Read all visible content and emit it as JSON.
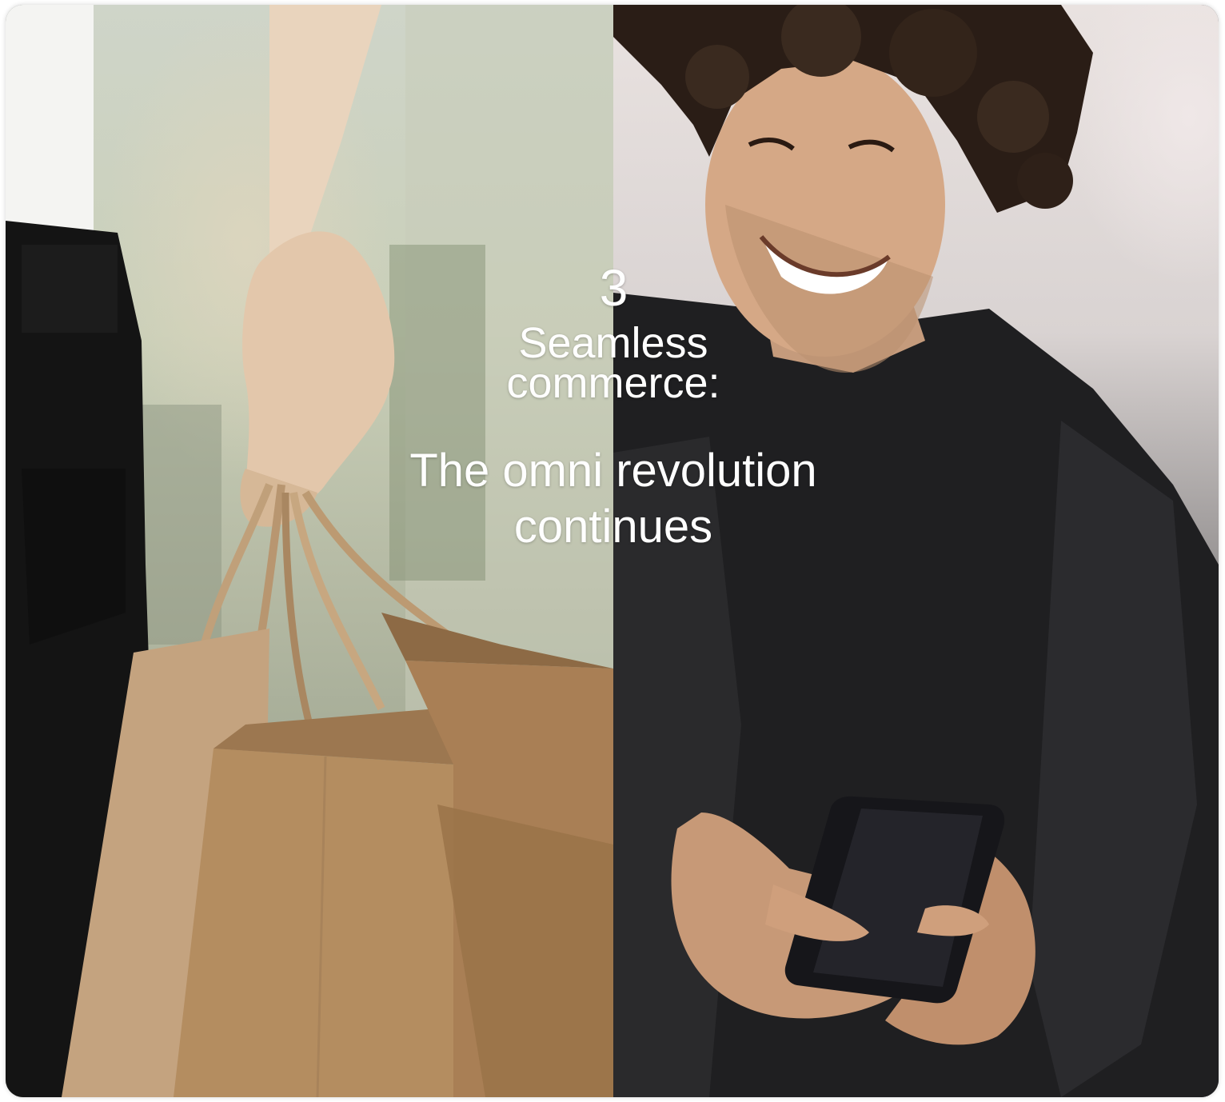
{
  "card": {
    "step_number": "3",
    "title_line_1": "Seamless",
    "title_line_2": "commerce:",
    "subtitle_line_1": "The omni revolution",
    "subtitle_line_2": "continues"
  },
  "images": {
    "left": "photo-hand-holding-shopping-bags",
    "right": "photo-man-smiling-at-smartphone"
  },
  "colors": {
    "text": "#ffffff",
    "bag_kraft": "#b08a5f",
    "sweater": "#1f1f21"
  }
}
